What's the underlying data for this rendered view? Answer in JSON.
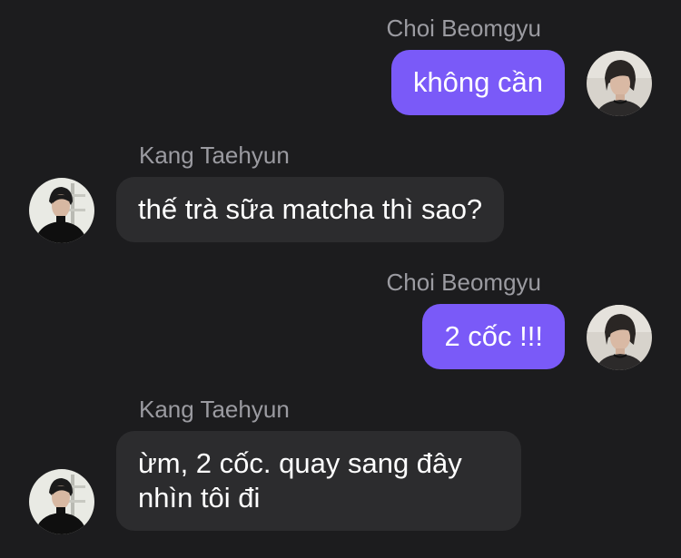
{
  "messages": [
    {
      "sender": "Choi Beomgyu",
      "text": "không cần",
      "direction": "outgoing"
    },
    {
      "sender": "Kang Taehyun",
      "text": "thế trà sữa matcha thì sao?",
      "direction": "incoming"
    },
    {
      "sender": "Choi Beomgyu",
      "text": "2 cốc !!!",
      "direction": "outgoing"
    },
    {
      "sender": "Kang Taehyun",
      "text": "ừm, 2 cốc. quay sang đây nhìn tôi đi",
      "direction": "incoming"
    }
  ],
  "colors": {
    "background": "#1c1c1e",
    "outgoing_bubble": "#7a5af8",
    "incoming_bubble": "#2c2c2e",
    "sender_name": "#9b9ba1",
    "text": "#ffffff"
  },
  "icons": {
    "outgoing_avatar": "avatar-photo",
    "incoming_avatar": "avatar-photo"
  }
}
